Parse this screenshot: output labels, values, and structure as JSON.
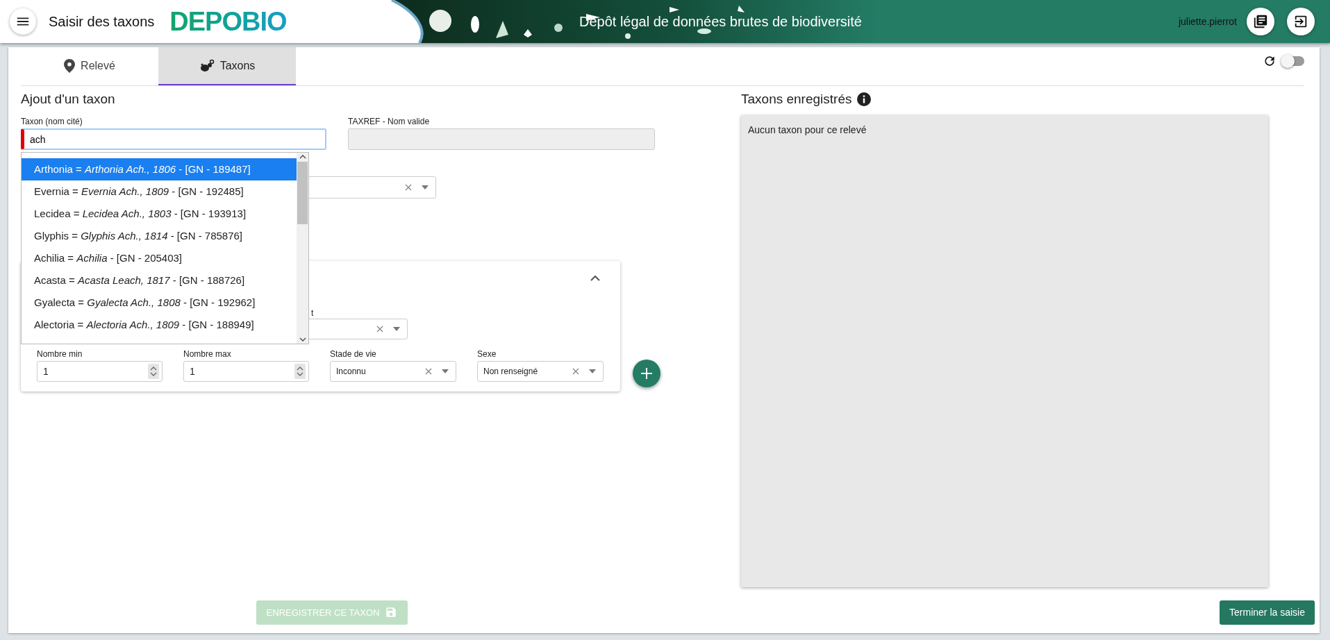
{
  "header": {
    "title": "Saisir des taxons",
    "logo": "DEPOBIO",
    "banner_title": "Dépôt légal de données brutes de biodiversité",
    "username": "juliette.pierrot"
  },
  "tabs": [
    {
      "label": "Relevé",
      "selected": false
    },
    {
      "label": "Taxons",
      "selected": true
    }
  ],
  "sync_toggle": {
    "on": false
  },
  "form": {
    "heading": "Ajout d'un taxon",
    "taxon_field": {
      "label": "Taxon (nom cité)",
      "value": "ach",
      "invalid": true
    },
    "taxref_field": {
      "label": "TAXREF - Nom valide",
      "disabled": true
    },
    "suggestions": [
      {
        "text": "Arthonia = *Arthonia Ach., 1806* - [GN - 189487]",
        "selected": true
      },
      {
        "text": "Evernia = *Evernia Ach., 1809* - [GN - 192485]",
        "selected": false
      },
      {
        "text": "Lecidea = *Lecidea Ach., 1803* - [GN - 193913]",
        "selected": false
      },
      {
        "text": "Glyphis = *Glyphis Ach., 1814* - [GN - 785876]",
        "selected": false
      },
      {
        "text": "Achilia = *Achilia* - [GN - 205403]",
        "selected": false
      },
      {
        "text": "Acasta = *Acasta Leach, 1817* - [GN - 188726]",
        "selected": false
      },
      {
        "text": "Gyalecta = *Gyalecta Ach., 1808* - [GN - 192962]",
        "selected": false
      },
      {
        "text": "Alectoria = *Alectoria Ach., 1809* - [GN - 188949]",
        "selected": false
      }
    ],
    "partial_label": "t",
    "counts": [
      {
        "label": "Nombre min",
        "value": "1",
        "kind": "number"
      },
      {
        "label": "Nombre max",
        "value": "1",
        "kind": "number"
      },
      {
        "label": "Stade de vie",
        "value": "Inconnu",
        "kind": "select"
      },
      {
        "label": "Sexe",
        "value": "Non renseigné",
        "kind": "select"
      }
    ]
  },
  "save_button": {
    "label": "ENREGISTRER CE TAXON",
    "disabled": true
  },
  "registered": {
    "heading": "Taxons enregistrés",
    "empty_text": "Aucun taxon pour ce relevé"
  },
  "finish_button": {
    "label": "Terminer la saisie"
  }
}
